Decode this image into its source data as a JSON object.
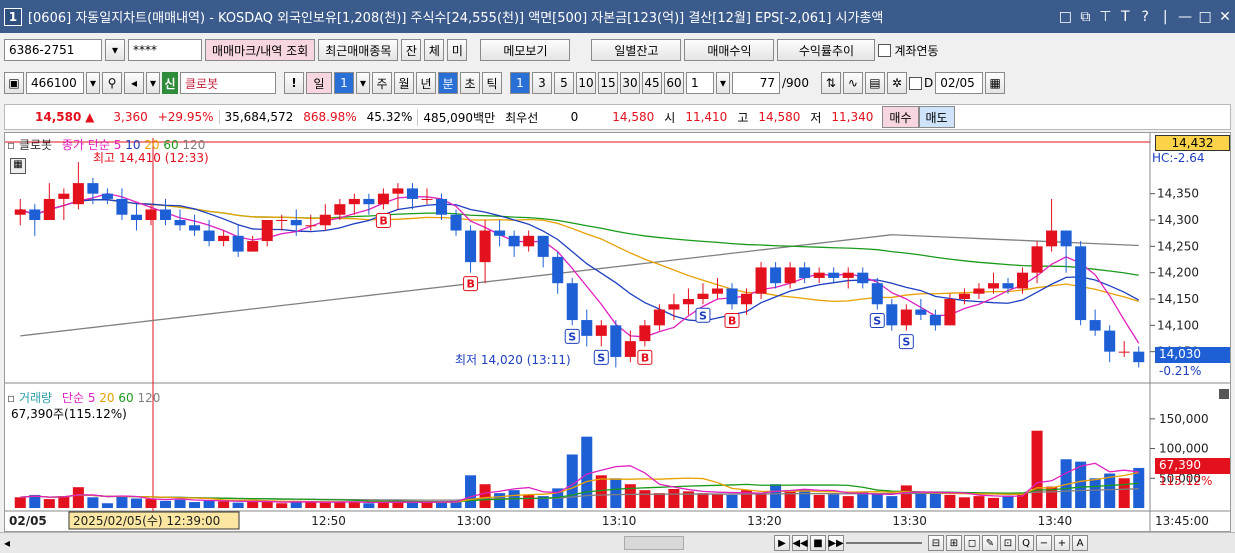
{
  "window": {
    "num": "1",
    "title": "[0606] 자동일지차트(매매내역) - KOSDAQ 외국인보유[1,208(천)] 주식수[24,555(천)] 액면[500] 자본금[123(억)] 결산[12월] EPS[-2,061] 시가총액",
    "controls": [
      "□",
      "⧉",
      "⊤",
      "T",
      "?",
      "|",
      "—",
      "□",
      "✕"
    ]
  },
  "toolbar1": {
    "account": "6386-2751",
    "password": "****",
    "btn_mark": "매매마크/내역 조회",
    "btn_recent": "최근매매종목",
    "btn_jan": "잔",
    "btn_che": "체",
    "btn_mi": "미",
    "btn_memo": "메모보기",
    "btn_daily": "일별잔고",
    "btn_profit": "매매수익",
    "btn_rate": "수익률추이",
    "chk_link": "계좌연동"
  },
  "toolbar2": {
    "code": "466100",
    "shin": "신",
    "name": "클로봇",
    "bang": "!",
    "il": "일",
    "il_num": "1",
    "ju": "주",
    "wol": "월",
    "nyeon": "년",
    "bun": "분",
    "cho": "초",
    "tik": "틱",
    "intervals": [
      "1",
      "3",
      "5",
      "10",
      "15",
      "30",
      "45",
      "60"
    ],
    "count": "1",
    "range": "77",
    "range_total": "/900",
    "d_label": "D",
    "date": "02/05"
  },
  "quote": {
    "price": "14,580",
    "arrow": "▲",
    "change": "3,360",
    "pct": "+29.95%",
    "volume": "35,684,572",
    "vol_ratio": "868.98%",
    "turn": "45.32%",
    "amount": "485,090백만",
    "best_label": "최우선",
    "best_val": "0",
    "best_price": "14,580",
    "open_label": "시",
    "open": "11,410",
    "high_label": "고",
    "high": "14,580",
    "low_label": "저",
    "low": "11,340",
    "buy": "매수",
    "sell": "매도"
  },
  "chart_data": {
    "type": "candlestick",
    "title": "클로봇",
    "ma_legend": [
      "종가 단순 5",
      "10",
      "20",
      "60",
      "120"
    ],
    "ma_colors": [
      "#e020c0",
      "#1e3fbf",
      "#e8a000",
      "#1a9a1a",
      "#808080"
    ],
    "yaxis": [
      "14,350",
      "14,300",
      "14,250",
      "14,200",
      "14,150",
      "14,100",
      "14,050"
    ],
    "ylim": [
      14000,
      14450
    ],
    "price_box": "14,432",
    "hc_label": "HC:-2.64",
    "last_box": "14,030",
    "last_pct": "-0.21%",
    "max_label": "최고 14,410 (12:33)",
    "min_label": "최저 14,020 (13:11)",
    "xaxis": [
      "12:50",
      "13:00",
      "13:10",
      "13:20",
      "13:30",
      "13:40",
      "13:45:00"
    ],
    "date_label": "02/05",
    "cursor_label": "2025/02/05(수) 12:39:00",
    "candles": [
      [
        14310,
        14340,
        14290,
        14320
      ],
      [
        14320,
        14330,
        14270,
        14300
      ],
      [
        14300,
        14370,
        14300,
        14340
      ],
      [
        14340,
        14360,
        14300,
        14350
      ],
      [
        14330,
        14410,
        14320,
        14370
      ],
      [
        14370,
        14380,
        14330,
        14350
      ],
      [
        14350,
        14360,
        14330,
        14340
      ],
      [
        14340,
        14360,
        14300,
        14310
      ],
      [
        14310,
        14330,
        14280,
        14300
      ],
      [
        14300,
        14330,
        14290,
        14320
      ],
      [
        14320,
        14340,
        14290,
        14300
      ],
      [
        14300,
        14320,
        14280,
        14290
      ],
      [
        14290,
        14310,
        14270,
        14280
      ],
      [
        14280,
        14300,
        14250,
        14260
      ],
      [
        14260,
        14280,
        14250,
        14270
      ],
      [
        14270,
        14290,
        14230,
        14240
      ],
      [
        14240,
        14270,
        14240,
        14260
      ],
      [
        14260,
        14300,
        14250,
        14300
      ],
      [
        14300,
        14310,
        14280,
        14300
      ],
      [
        14300,
        14320,
        14270,
        14290
      ],
      [
        14290,
        14310,
        14280,
        14290
      ],
      [
        14290,
        14330,
        14280,
        14310
      ],
      [
        14310,
        14340,
        14300,
        14330
      ],
      [
        14330,
        14350,
        14310,
        14340
      ],
      [
        14340,
        14350,
        14310,
        14330
      ],
      [
        14330,
        14360,
        14320,
        14350
      ],
      [
        14350,
        14370,
        14320,
        14360
      ],
      [
        14360,
        14370,
        14320,
        14340
      ],
      [
        14340,
        14360,
        14330,
        14340
      ],
      [
        14340,
        14350,
        14300,
        14310
      ],
      [
        14310,
        14320,
        14270,
        14280
      ],
      [
        14280,
        14290,
        14200,
        14220
      ],
      [
        14220,
        14300,
        14180,
        14280
      ],
      [
        14280,
        14300,
        14250,
        14270
      ],
      [
        14270,
        14280,
        14230,
        14250
      ],
      [
        14250,
        14280,
        14240,
        14270
      ],
      [
        14270,
        14270,
        14210,
        14230
      ],
      [
        14230,
        14240,
        14160,
        14180
      ],
      [
        14180,
        14190,
        14100,
        14110
      ],
      [
        14110,
        14130,
        14060,
        14080
      ],
      [
        14080,
        14110,
        14060,
        14100
      ],
      [
        14100,
        14110,
        14020,
        14040
      ],
      [
        14040,
        14090,
        14030,
        14070
      ],
      [
        14070,
        14110,
        14060,
        14100
      ],
      [
        14100,
        14140,
        14090,
        14130
      ],
      [
        14130,
        14160,
        14110,
        14140
      ],
      [
        14140,
        14170,
        14120,
        14150
      ],
      [
        14150,
        14180,
        14140,
        14160
      ],
      [
        14160,
        14190,
        14150,
        14170
      ],
      [
        14170,
        14180,
        14130,
        14140
      ],
      [
        14140,
        14170,
        14120,
        14160
      ],
      [
        14160,
        14220,
        14150,
        14210
      ],
      [
        14210,
        14220,
        14170,
        14180
      ],
      [
        14180,
        14220,
        14170,
        14210
      ],
      [
        14210,
        14220,
        14180,
        14190
      ],
      [
        14190,
        14210,
        14180,
        14200
      ],
      [
        14200,
        14210,
        14180,
        14190
      ],
      [
        14190,
        14210,
        14170,
        14200
      ],
      [
        14200,
        14210,
        14170,
        14180
      ],
      [
        14180,
        14190,
        14130,
        14140
      ],
      [
        14140,
        14150,
        14090,
        14100
      ],
      [
        14100,
        14140,
        14090,
        14130
      ],
      [
        14130,
        14150,
        14110,
        14120
      ],
      [
        14120,
        14130,
        14090,
        14100
      ],
      [
        14100,
        14160,
        14100,
        14150
      ],
      [
        14150,
        14170,
        14140,
        14160
      ],
      [
        14160,
        14180,
        14150,
        14170
      ],
      [
        14170,
        14200,
        14160,
        14180
      ],
      [
        14180,
        14190,
        14160,
        14170
      ],
      [
        14170,
        14210,
        14160,
        14200
      ],
      [
        14200,
        14260,
        14180,
        14250
      ],
      [
        14250,
        14340,
        14240,
        14280
      ],
      [
        14280,
        14280,
        14200,
        14250
      ],
      [
        14250,
        14260,
        14100,
        14110
      ],
      [
        14110,
        14130,
        14080,
        14090
      ],
      [
        14090,
        14100,
        14030,
        14050
      ],
      [
        14050,
        14070,
        14040,
        14050
      ],
      [
        14050,
        14060,
        14020,
        14030
      ]
    ],
    "signals": [
      {
        "i": 25,
        "t": "B"
      },
      {
        "i": 31,
        "t": "B"
      },
      {
        "i": 38,
        "t": "S"
      },
      {
        "i": 40,
        "t": "S"
      },
      {
        "i": 43,
        "t": "B"
      },
      {
        "i": 47,
        "t": "S"
      },
      {
        "i": 49,
        "t": "B"
      },
      {
        "i": 59,
        "t": "S"
      },
      {
        "i": 61,
        "t": "S"
      }
    ],
    "vol_legend": [
      "거래량",
      "단순 5",
      "20",
      "60",
      "120"
    ],
    "vol_info": "67,390주(115.12%)",
    "vol_axis": [
      "150,000",
      "100,000",
      "50,000"
    ],
    "vol_box": "67,390",
    "vol_pct": "115.12%",
    "volumes": [
      18000,
      22000,
      15000,
      20000,
      35000,
      18000,
      8000,
      20000,
      16000,
      15000,
      12000,
      14000,
      10000,
      13000,
      11000,
      9000,
      12000,
      10000,
      8000,
      12000,
      10000,
      9000,
      11000,
      10000,
      8000,
      9000,
      12000,
      10000,
      9000,
      10000,
      11000,
      55000,
      40000,
      25000,
      30000,
      22000,
      20000,
      33000,
      90000,
      120000,
      55000,
      50000,
      40000,
      30000,
      25000,
      32000,
      28000,
      25000,
      23000,
      22000,
      30000,
      25000,
      40000,
      30000,
      32000,
      22000,
      23000,
      20000,
      27000,
      25000,
      20000,
      38000,
      24000,
      25000,
      22000,
      18000,
      20000,
      17000,
      21000,
      25000,
      130000,
      36000,
      82000,
      78000,
      50000,
      58000,
      50000,
      67390
    ]
  },
  "bottom": {
    "controls": [
      "▶",
      "◀◀",
      "■",
      "▶▶",
      "⊢",
      "⊟",
      "⊞",
      "◻",
      "✎",
      "⊡",
      "Q",
      "−",
      "+",
      "A"
    ]
  }
}
